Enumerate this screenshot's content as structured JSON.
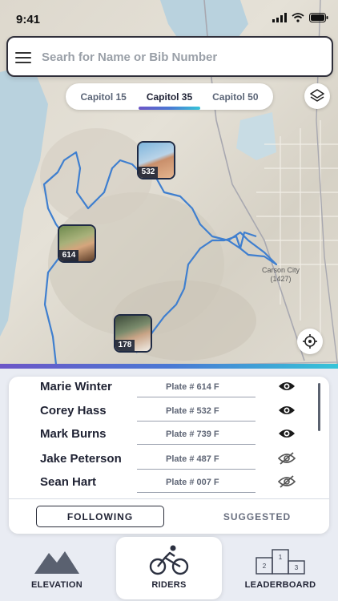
{
  "status": {
    "time": "9:41"
  },
  "search": {
    "placeholder": "Searh for Name or Bib Number"
  },
  "segments": [
    {
      "label": "Capitol 15",
      "active": false
    },
    {
      "label": "Capitol 35",
      "active": true
    },
    {
      "label": "Capitol 50",
      "active": false
    }
  ],
  "map": {
    "city_label_line1": "Carson City",
    "city_label_line2": "(1427)",
    "route_color": "#3f7fcf",
    "markers": [
      {
        "bib": "532"
      },
      {
        "bib": "614"
      },
      {
        "bib": "178"
      }
    ]
  },
  "riders": [
    {
      "name": "Marie Winter",
      "plate": "Plate # 614  F",
      "following": true
    },
    {
      "name": "Corey Hass",
      "plate": "Plate # 532  F",
      "following": true
    },
    {
      "name": "Mark Burns",
      "plate": "Plate # 739  F",
      "following": true
    },
    {
      "name": "Jake Peterson",
      "plate": "Plate # 487  F",
      "following": false
    },
    {
      "name": "Sean Hart",
      "plate": "Plate # 007  F",
      "following": false
    }
  ],
  "list_tabs": {
    "following": "FOLLOWING",
    "suggested": "SUGGESTED"
  },
  "nav": {
    "elevation": "ELEVATION",
    "riders": "RIDERS",
    "leaderboard": "LEADERBOARD",
    "active": "riders"
  },
  "colors": {
    "accent_start": "#6c56c7",
    "accent_mid": "#4a78d4",
    "accent_end": "#36c4d8",
    "dark": "#1f2233"
  }
}
